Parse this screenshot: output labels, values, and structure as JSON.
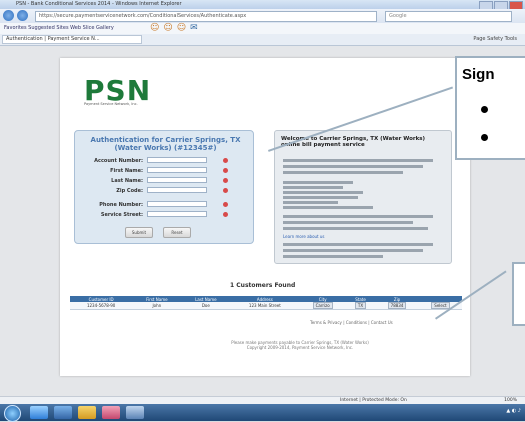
{
  "browser": {
    "title": "PSN - Bank Conditional Services 2014 - Windows Internet Explorer",
    "address": "https://secure.paymentservicenetwork.com/ConditionalServices/Authenticate.aspx",
    "search_placeholder": "Google",
    "toolbar_links": "Favorites  Suggested Sites  Web Slice Gallery",
    "tab_label": "Authentication | Payment Service N...",
    "tab_commands": "Page  Safety  Tools"
  },
  "logo": {
    "text": "PSN",
    "subtitle": "Payment Service Network, Inc."
  },
  "auth": {
    "title": "Authentication for Carrier Springs, TX (Water Works) (#12345#)",
    "fields": [
      {
        "label": "Account Number:",
        "value": ""
      },
      {
        "label": "First Name:",
        "value": ""
      },
      {
        "label": "Last Name:",
        "value": ""
      },
      {
        "label": "Zip Code:",
        "value": ""
      },
      {
        "label": "Phone Number:",
        "value": ""
      },
      {
        "label": "Service Street:",
        "value": ""
      }
    ],
    "submit_label": "Submit",
    "reset_label": "Reset"
  },
  "welcome": {
    "title": "Welcome to Carrier Springs, TX (Water Works) online bill payment service",
    "link": "Learn more about us"
  },
  "results": {
    "found_text": "1 Customers Found",
    "columns": [
      "Customer ID",
      "First Name",
      "Last Name",
      "Address",
      "City",
      "State",
      "Zip",
      ""
    ],
    "rows": [
      [
        "1234-5678-90",
        "John",
        "Doe",
        "123 Main Street",
        "Carrizo",
        "TX",
        "78834",
        "Select"
      ]
    ],
    "pager": "Terms & Privacy  |  Conditions  |  Contact Us"
  },
  "footer": {
    "line1": "Please make payments payable to Carrier Springs, TX (Water Works)",
    "line2": "Copyright 2009-2014, Payment Service Network, Inc."
  },
  "statusbar": {
    "zone": "Internet | Protected Mode: On",
    "zoom": "100%"
  },
  "callout": {
    "title": "Sign"
  },
  "colors": {
    "logo_green": "#1e7a3a",
    "panel_blue": "#4a78b0",
    "table_header": "#3a6ea5",
    "required_red": "#d84a4a"
  }
}
